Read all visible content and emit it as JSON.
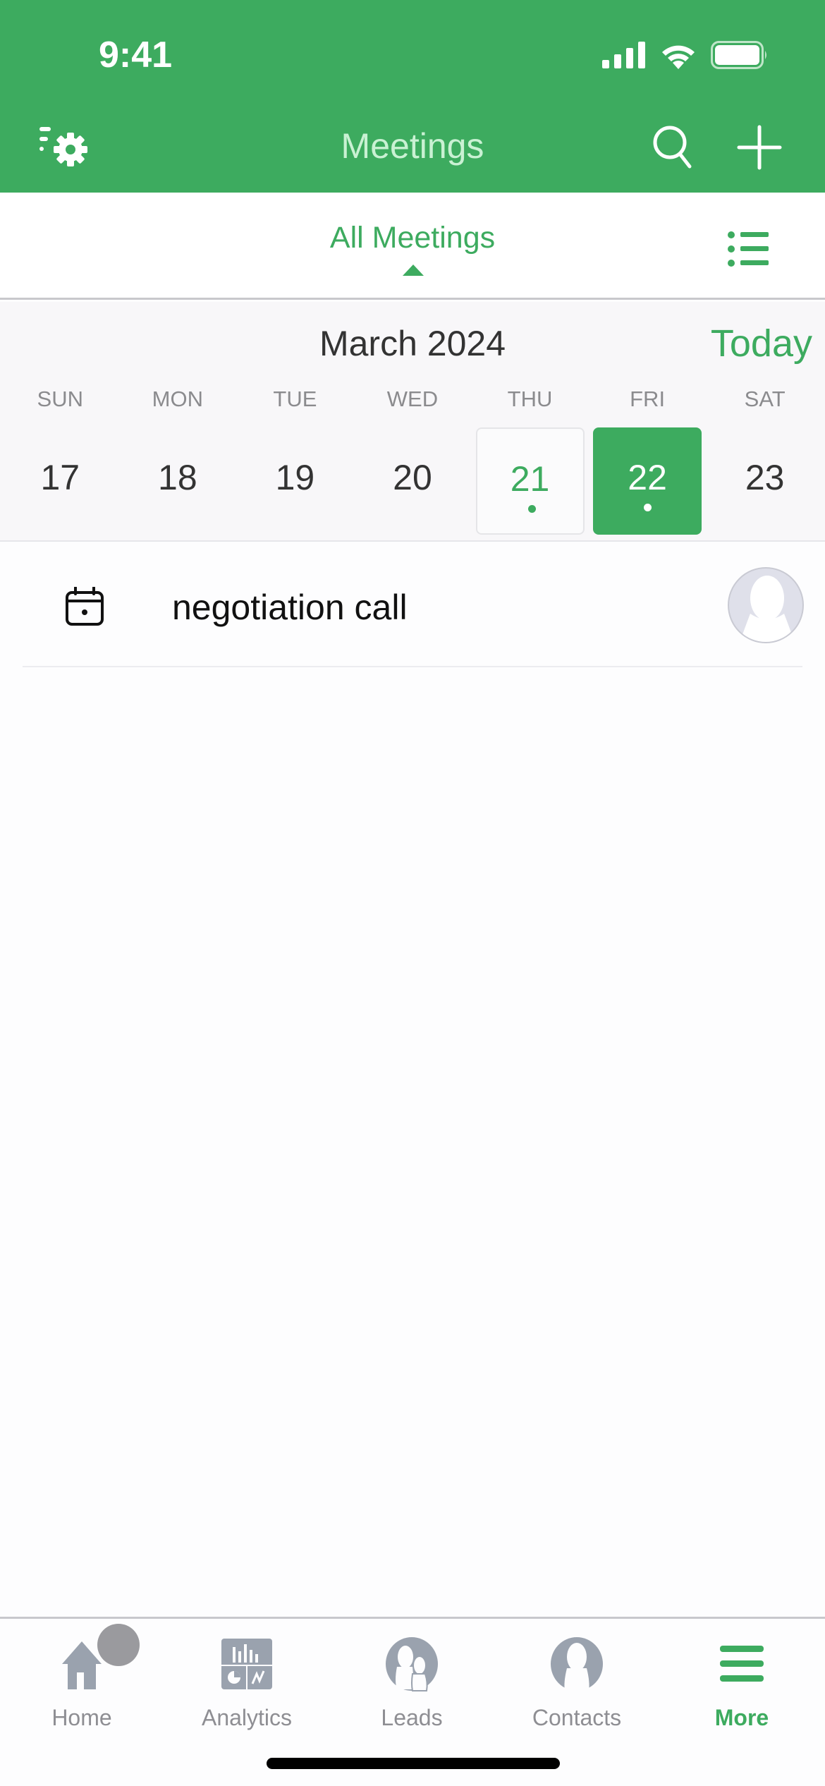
{
  "status_bar": {
    "time": "9:41",
    "icons": [
      "cellular-signal-icon",
      "wifi-icon",
      "battery-icon"
    ]
  },
  "nav_bar": {
    "title": "Meetings",
    "left_icon": "filter-settings-icon",
    "right_icons": [
      "search-icon",
      "add-icon"
    ]
  },
  "filter": {
    "label": "All Meetings",
    "caret_icon": "caret-up-icon",
    "view_toggle_icon": "list-view-icon"
  },
  "calendar": {
    "month_label": "March 2024",
    "today_label": "Today",
    "weekdays": [
      "SUN",
      "MON",
      "TUE",
      "WED",
      "THU",
      "FRI",
      "SAT"
    ],
    "days": [
      {
        "num": "17",
        "state": "normal",
        "has_event": false
      },
      {
        "num": "18",
        "state": "normal",
        "has_event": false
      },
      {
        "num": "19",
        "state": "normal",
        "has_event": false
      },
      {
        "num": "20",
        "state": "normal",
        "has_event": false
      },
      {
        "num": "21",
        "state": "today",
        "has_event": true
      },
      {
        "num": "22",
        "state": "selected",
        "has_event": true
      },
      {
        "num": "23",
        "state": "normal",
        "has_event": false
      }
    ]
  },
  "meetings": [
    {
      "title": "negotiation call",
      "icon": "calendar-icon",
      "avatar": "default-avatar"
    }
  ],
  "tab_bar": {
    "items": [
      {
        "label": "Home",
        "icon": "home-icon",
        "active": false
      },
      {
        "label": "Analytics",
        "icon": "analytics-icon",
        "active": false
      },
      {
        "label": "Leads",
        "icon": "leads-icon",
        "active": false
      },
      {
        "label": "Contacts",
        "icon": "contacts-icon",
        "active": false
      },
      {
        "label": "More",
        "icon": "menu-icon",
        "active": true
      }
    ]
  },
  "colors": {
    "brand_green": "#3dab5f",
    "title_light_green": "#c9f1d3",
    "inactive_gray": "#8e8e93",
    "icon_gray": "#9aa2ae"
  }
}
